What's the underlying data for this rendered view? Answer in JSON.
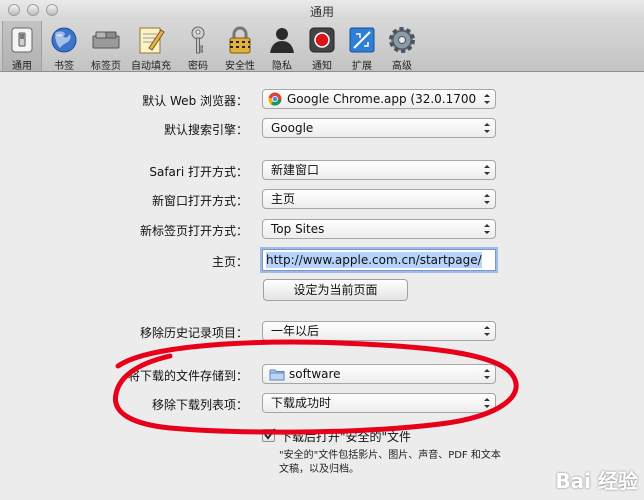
{
  "window": {
    "title": "通用"
  },
  "toolbar": {
    "items": [
      {
        "label": "通用",
        "icon": "switch-icon"
      },
      {
        "label": "书签",
        "icon": "globe-icon"
      },
      {
        "label": "标签页",
        "icon": "tabs-icon"
      },
      {
        "label": "自动填充",
        "icon": "pencil-icon"
      },
      {
        "label": "密码",
        "icon": "key-icon"
      },
      {
        "label": "安全性",
        "icon": "lock-icon"
      },
      {
        "label": "隐私",
        "icon": "person-icon"
      },
      {
        "label": "通知",
        "icon": "notification-icon"
      },
      {
        "label": "扩展",
        "icon": "puzzle-icon"
      },
      {
        "label": "高级",
        "icon": "gear-icon"
      }
    ],
    "selected": "通用"
  },
  "form": {
    "default_browser": {
      "label": "默认 Web 浏览器：",
      "value": "Google Chrome.app (32.0.1700"
    },
    "search_engine": {
      "label": "默认搜索引擎：",
      "value": "Google"
    },
    "safari_open": {
      "label": "Safari 打开方式：",
      "value": "新建窗口"
    },
    "new_window": {
      "label": "新窗口打开方式：",
      "value": "主页"
    },
    "new_tab": {
      "label": "新标签页打开方式：",
      "value": "Top Sites"
    },
    "homepage": {
      "label": "主页：",
      "value": "http://www.apple.com.cn/startpage/"
    },
    "set_current_button": "设定为当前页面",
    "remove_history": {
      "label": "移除历史记录项目：",
      "value": "一年以后"
    },
    "download_location": {
      "label": "将下载的文件存储到：",
      "value": "software"
    },
    "remove_downloads": {
      "label": "移除下载列表项：",
      "value": "下载成功时"
    },
    "open_safe": {
      "label": "下载后打开\"安全的\"文件",
      "checked": true
    },
    "open_safe_note_1": "\"安全的\"文件包括影片、图片、声音、PDF 和文本",
    "open_safe_note_2": "文稿，以及归档。"
  },
  "watermark": "Bai 经验",
  "colors": {
    "annotation": "#e8001b",
    "focus": "#9cbbe9"
  }
}
